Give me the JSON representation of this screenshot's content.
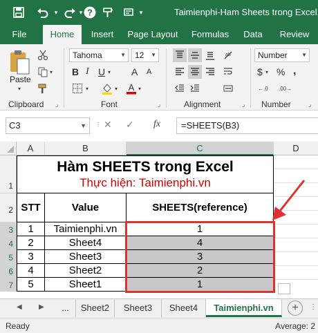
{
  "titlebar": {
    "title": "Taimienphi-Ham Sheets trong Excel.xls",
    "save_icon": "save-icon",
    "undo_icon": "undo-icon",
    "redo_icon": "redo-icon",
    "help_icon": "help-icon",
    "format_icon": "format-painter-icon"
  },
  "tabs": [
    "File",
    "Home",
    "Insert",
    "Page Layout",
    "Formulas",
    "Data",
    "Review"
  ],
  "ribbon": {
    "paste_label": "Paste",
    "clipboard_label": "Clipboard",
    "font_label": "Font",
    "alignment_label": "Alignment",
    "number_label": "Number",
    "font_name": "Tahoma",
    "font_size": "12",
    "number_format": "Number",
    "bold": "B",
    "italic": "I",
    "underline": "U",
    "font_grow": "A",
    "font_shrink": "A",
    "currency": "$",
    "percent": "%",
    "comma": ","
  },
  "formula_bar": {
    "name_box": "C3",
    "fx_label": "fx",
    "formula": "=SHEETS(B3)"
  },
  "grid": {
    "columns": [
      "A",
      "B",
      "C",
      "D"
    ],
    "rows": [
      "1",
      "2",
      "3",
      "4",
      "5",
      "6",
      "7"
    ],
    "title": "Hàm SHEETS trong Excel",
    "subtitle": "Thực hiện: Taimienphi.vn",
    "headers": [
      "STT",
      "Value",
      "SHEETS(reference)"
    ],
    "data": [
      {
        "stt": "1",
        "value": "Taimienphi.vn",
        "result": "1"
      },
      {
        "stt": "2",
        "value": "Sheet4",
        "result": "4"
      },
      {
        "stt": "3",
        "value": "Sheet3",
        "result": "3"
      },
      {
        "stt": "4",
        "value": "Sheet2",
        "result": "2"
      },
      {
        "stt": "5",
        "value": "Sheet1",
        "result": "1"
      }
    ]
  },
  "sheets": {
    "ellipsis": "...",
    "tabs": [
      "Sheet2",
      "Sheet3",
      "Sheet4",
      "Taimienphi.vn"
    ],
    "add": "+"
  },
  "status": {
    "ready": "Ready",
    "average": "Average: 2"
  },
  "colors": {
    "accent": "#217346",
    "annotation": "#e03131",
    "title_text": "#000000",
    "subtitle_text": "#d10000"
  }
}
